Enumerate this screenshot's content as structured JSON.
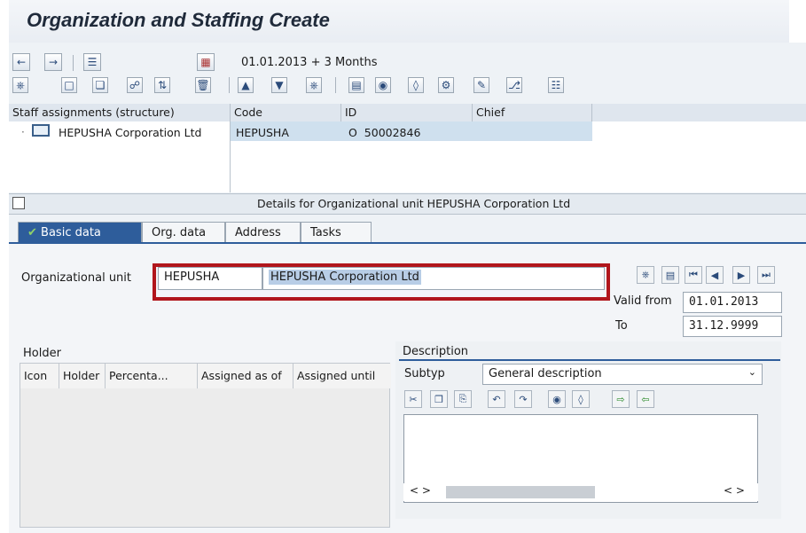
{
  "window": {
    "title": "Organization and Staffing Create"
  },
  "toolbar": {
    "date_range": "01.01.2013  + 3 Months",
    "icons_row1": [
      "back-arrow-icon",
      "forward-arrow-icon",
      "list-icon",
      "calendar-icon"
    ],
    "icons_row2": [
      "hierarchy-icon",
      "new-icon",
      "copy-icon",
      "org-icon",
      "move-icon",
      "delete-icon",
      "up-icon",
      "down-icon",
      "structure-icon",
      "print-icon",
      "find-icon",
      "find-next-icon",
      "settings-icon",
      "note-icon",
      "tree-icon",
      "columns-icon"
    ]
  },
  "tree": {
    "headers": [
      "Staff assignments (structure)",
      "Code",
      "ID",
      "Chief"
    ],
    "rows": [
      {
        "name": "HEPUSHA Corporation Ltd",
        "code": "HEPUSHA",
        "id": "O  50002846",
        "chief": ""
      }
    ]
  },
  "details": {
    "title": "Details for Organizational unit HEPUSHA Corporation Ltd",
    "tabs": [
      "Basic data",
      "Org. data",
      "Address",
      "Tasks"
    ],
    "org_unit_label": "Organizational unit",
    "org_unit_code": "HEPUSHA",
    "org_unit_name": "HEPUSHA Corporation Ltd",
    "valid_from_label": "Valid from",
    "valid_from": "01.01.2013",
    "to_label": "To",
    "to": "31.12.9999"
  },
  "holder": {
    "title": "Holder",
    "columns": [
      "Icon",
      "Holder",
      "Percenta...",
      "Assigned as of",
      "Assigned until"
    ]
  },
  "description": {
    "title": "Description",
    "subtyp_label": "Subtyp",
    "subtyp_value": "General description"
  },
  "colors": {
    "accent": "#2e5d9b",
    "highlight": "#b1161c",
    "selection": "#cfe0ee"
  }
}
